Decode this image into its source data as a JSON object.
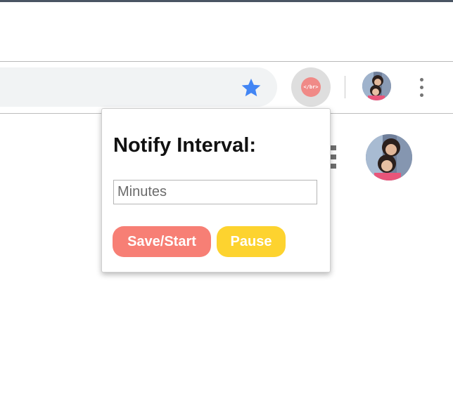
{
  "extension": {
    "icon_text": "</br>"
  },
  "popup": {
    "title": "Notify Interval:",
    "minutes_input": {
      "placeholder": "Minutes",
      "value": ""
    },
    "save_button": "Save/Start",
    "pause_button": "Pause"
  },
  "colors": {
    "save_button": "#f77f75",
    "pause_button": "#fdd32f",
    "star": "#4285f4",
    "extension_icon": "#f08a87"
  },
  "icons": [
    "star-icon",
    "extension-icon",
    "profile-avatar",
    "more-menu-icon"
  ]
}
